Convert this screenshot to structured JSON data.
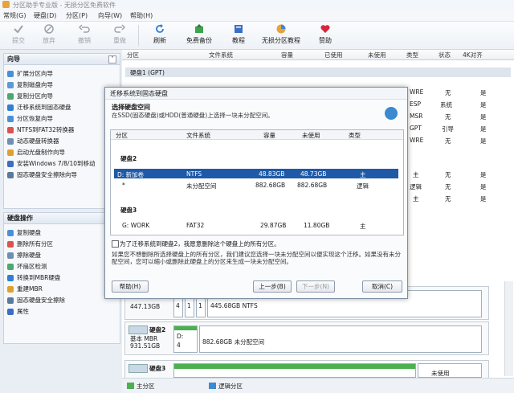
{
  "app": {
    "title": "分区助手专业版 - 无损分区免费软件"
  },
  "menu": [
    "常规(G)",
    "硬盘(D)",
    "分区(P)",
    "向导(W)",
    "帮助(H)"
  ],
  "toolbar": {
    "commit": "提交",
    "discard": "放弃",
    "undo": "撤销",
    "redo": "重做",
    "refresh": "刷新",
    "free_backup": "免费备份",
    "tutorial": "教程",
    "lossless_tutorial": "无损分区教程",
    "donate": "赞助"
  },
  "wizard_panel": {
    "title": "向导",
    "items": [
      "扩展分区向导",
      "复制磁盘向导",
      "复制分区向导",
      "迁移系统到固态硬盘",
      "分区恢复向导",
      "NTFS到FAT32转换器",
      "动态硬盘转换器",
      "启动光盘制作向导",
      "安装Windows 7/8/10到移动",
      "固态硬盘安全擦除向导"
    ]
  },
  "disk_ops_panel": {
    "title": "硬盘操作",
    "items": [
      "复制硬盘",
      "删除所有分区",
      "擦除硬盘",
      "坏扇区检测",
      "转换到MBR硬盘",
      "重建MBR",
      "固态硬盘安全擦除",
      "属性"
    ]
  },
  "grid": {
    "headers": [
      "分区",
      "文件系统",
      "容量",
      "已使用",
      "未使用",
      "类型",
      "状态",
      "4K对齐"
    ],
    "disk1_label": "硬盘1 (GPT)",
    "rows": [
      {
        "type": "WRE",
        "status": "无",
        "align": "是"
      },
      {
        "type": "ESP",
        "status": "系统",
        "align": "是"
      },
      {
        "type": "MSR",
        "status": "无",
        "align": "是"
      },
      {
        "type": "GPT",
        "status": "引导",
        "align": "是"
      },
      {
        "type": "WRE",
        "status": "无",
        "align": "是"
      },
      {
        "type": "主",
        "status": "无",
        "align": "是"
      },
      {
        "type": "逻辑",
        "status": "无",
        "align": "是"
      },
      {
        "type": "主",
        "status": "无",
        "align": "是"
      }
    ]
  },
  "disk_maps": [
    {
      "size": "447.13GB",
      "cells": [
        "4",
        "1",
        "1"
      ],
      "seg_label": "445.68GB NTFS"
    },
    {
      "name": "硬盘2",
      "type": "基本 MBR",
      "size": "931.51GB",
      "cells": [
        "D:",
        "4"
      ],
      "seg_label": "882.68GB 未分配空间"
    },
    {
      "name": "硬盘3",
      "free": "未使用"
    }
  ],
  "legend": {
    "primary": "主分区",
    "logical": "逻辑分区"
  },
  "dialog": {
    "title": "迁移系统到固态硬盘",
    "subtitle": "选择硬盘空间",
    "desc": "在SSD(固态硬盘)或HDD(普通硬盘)上选择一块未分配空间。",
    "columns": [
      "分区",
      "文件系统",
      "容量",
      "未使用",
      "类型"
    ],
    "group1": "硬盘2",
    "group2": "硬盘3",
    "rows": [
      {
        "part": "D: 新加卷",
        "fs": "NTFS",
        "cap": "48.83GB",
        "free": "48.73GB",
        "type": "主"
      },
      {
        "part": "*",
        "fs": "未分配空间",
        "cap": "882.68GB",
        "free": "882.68GB",
        "type": "逻辑"
      },
      {
        "part": "G: WORK",
        "fs": "FAT32",
        "cap": "29.87GB",
        "free": "11.80GB",
        "type": "主"
      }
    ],
    "checkbox": "为了迁移系统到硬盘2，我愿意删除这个硬盘上的所有分区。",
    "note": "如果您不想删除所选择硬盘上的所有分区，我们建议您选择一块未分配空间以便实现这个迁移。如果没有未分配空间，您可以缩小或删除此硬盘上的分区来生成一块未分配空间。",
    "help": "帮助(H)",
    "back": "上一步(B)",
    "next": "下一步(N)",
    "cancel": "取消(C)"
  }
}
